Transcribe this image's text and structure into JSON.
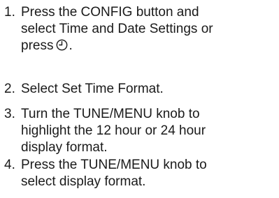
{
  "steps": [
    {
      "number": "1.",
      "lines": [
        "Press the CONFIG button and",
        "select Time and Date Settings or",
        "press"
      ],
      "icon": "clock-icon",
      "end": "."
    },
    {
      "number": "2.",
      "lines": [
        "Select Set Time Format."
      ]
    },
    {
      "number": "3.",
      "lines": [
        "Turn the TUNE/MENU knob to",
        "highlight the 12 hour or 24 hour",
        "display format."
      ]
    },
    {
      "number": "4.",
      "lines": [
        "Press the TUNE/MENU knob to",
        "select display format."
      ]
    }
  ]
}
